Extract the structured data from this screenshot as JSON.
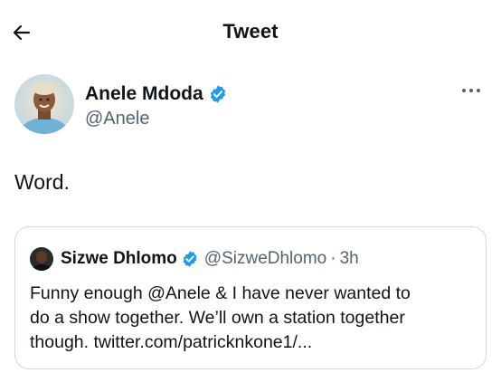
{
  "header": {
    "title": "Tweet",
    "back_icon": "arrow-left-icon"
  },
  "tweet": {
    "author_name": "Anele Mdoda",
    "author_handle": "@Anele",
    "verified": true,
    "text": "Word.",
    "more_icon": "ellipsis-icon"
  },
  "quoted_tweet": {
    "author_name": "Sizwe Dhlomo",
    "author_handle": "@SizweDhlomo",
    "separator": "·",
    "time": "3h",
    "verified": true,
    "text_lines": [
      "Funny enough @Anele & I have never wanted to",
      "do a show together. We’ll own a station together",
      "though. twitter.com/patricknkone1/..."
    ]
  },
  "colors": {
    "text_primary": "#0f1419",
    "text_secondary": "#536471",
    "verified_blue": "#1d9bf0",
    "border": "#cfd9de"
  }
}
